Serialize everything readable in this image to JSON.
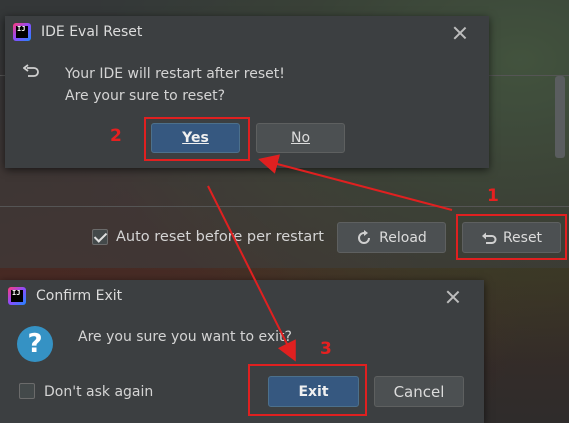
{
  "colors": {
    "dialog_bg": "#3c3f41",
    "primary_button": "#365880",
    "annotation_red": "#e02020"
  },
  "reset_dialog": {
    "title": "IDE Eval Reset",
    "line1": "Your IDE will restart after reset!",
    "line2": "Are your sure to reset?",
    "yes_label": "Yes",
    "no_label": "No"
  },
  "main_window": {
    "auto_reset_label": "Auto reset before per restart",
    "auto_reset_checked": true,
    "reload_label": "Reload",
    "reset_label": "Reset"
  },
  "confirm_exit": {
    "title": "Confirm Exit",
    "message": "Are you sure you want to exit?",
    "dont_ask_label": "Don't ask again",
    "dont_ask_checked": false,
    "exit_label": "Exit",
    "cancel_label": "Cancel"
  },
  "annotations": {
    "step1": "1",
    "step2": "2",
    "step3": "3"
  },
  "icons": [
    "ij-logo-icon",
    "close-icon",
    "undo-icon",
    "reload-icon",
    "question-icon"
  ]
}
